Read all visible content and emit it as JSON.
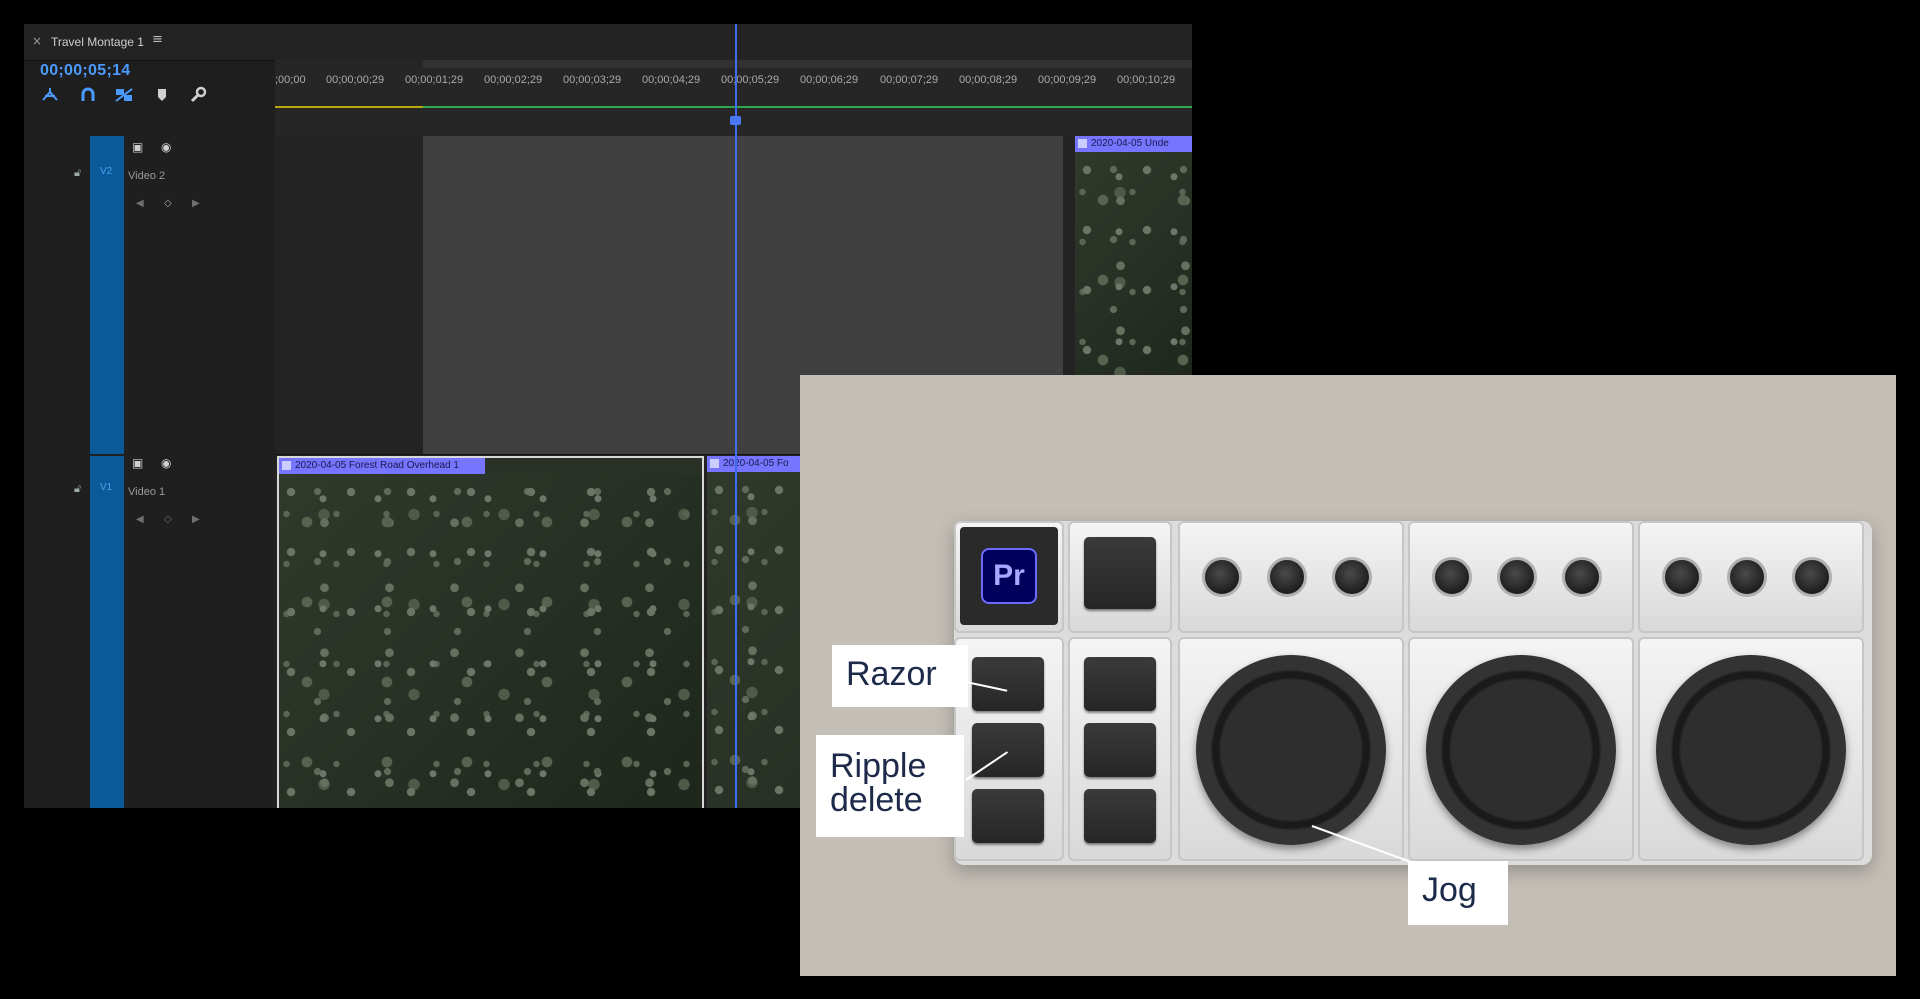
{
  "timeline": {
    "tab_close": "×",
    "title": "Travel Montage 1",
    "menu_icon": "≡",
    "timecode": "00;00;05;14",
    "tools": [
      "snap-icon",
      "magnet-icon",
      "linked-selection-icon",
      "marker-icon",
      "wrench-icon"
    ],
    "ruler_ticks": [
      ";00;00",
      "00;00;00;29",
      "00;00;01;29",
      "00;00;02;29",
      "00;00;03;29",
      "00;00;04;29",
      "00;00;05;29",
      "00;00;06;29",
      "00;00;07;29",
      "00;00;08;29",
      "00;00;09;29",
      "00;00;10;29"
    ],
    "tracks": {
      "v2": {
        "id": "V2",
        "name": "Video 2"
      },
      "v1": {
        "id": "V1",
        "name": "Video 1"
      }
    },
    "clips": {
      "v2_right": "2020-04-05 Unde",
      "v1_left": "2020-04-05 Forest Road Overhead 1",
      "v1_right": "2020-04-05 Fo"
    },
    "colors": {
      "accent": "#4b9bff",
      "track_strip": "#0a5a9a",
      "clip_label": "#7575ff",
      "playhead": "#3d6cf0"
    }
  },
  "hardware": {
    "app_logo": "Pr",
    "callouts": {
      "razor": "Razor",
      "ripple_delete": [
        "Ripple",
        "delete"
      ],
      "jog": "Jog"
    }
  }
}
